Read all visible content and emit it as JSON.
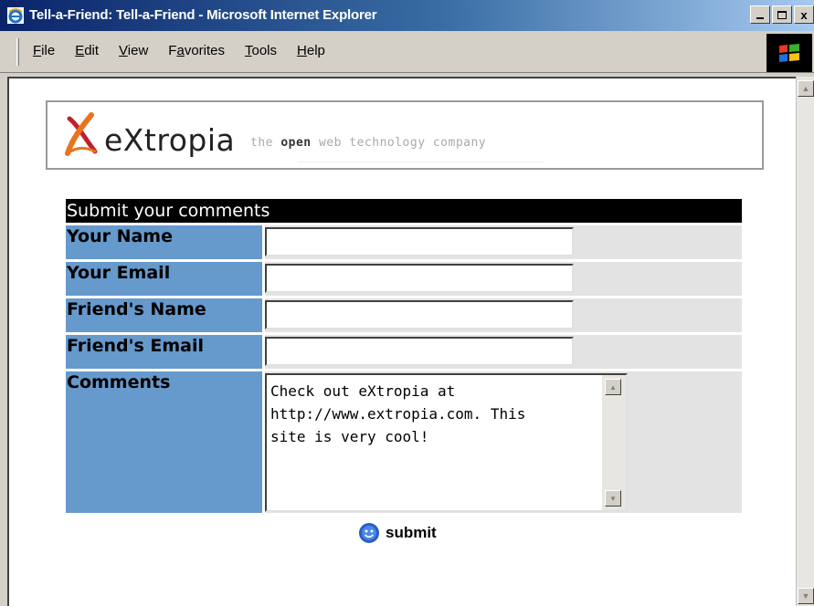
{
  "window": {
    "title": "Tell-a-Friend: Tell-a-Friend - Microsoft Internet Explorer",
    "controls": {
      "minimize": "_",
      "maximize": "□",
      "close": "x"
    }
  },
  "menu": {
    "items": [
      {
        "label": "File",
        "accel": "F"
      },
      {
        "label": "Edit",
        "accel": "E"
      },
      {
        "label": "View",
        "accel": "V"
      },
      {
        "label": "Favorites",
        "accel": "a"
      },
      {
        "label": "Tools",
        "accel": "T"
      },
      {
        "label": "Help",
        "accel": "H"
      }
    ]
  },
  "logo": {
    "wordmark": "eXtropia",
    "tagline_pre": "the ",
    "tagline_bold": "open",
    "tagline_post": " web technology company"
  },
  "form": {
    "header": "Submit your comments",
    "fields": [
      {
        "label": "Your Name",
        "value": ""
      },
      {
        "label": "Your Email",
        "value": ""
      },
      {
        "label": "Friend's Name",
        "value": ""
      },
      {
        "label": "Friend's Email",
        "value": ""
      }
    ],
    "comments_label": "Comments",
    "comments_value": "Check out eXtropia at\nhttp://www.extropia.com. This\nsite is very cool!",
    "submit_label": "submit"
  },
  "colors": {
    "label_bg": "#6699cc",
    "header_bg": "#000000",
    "input_cell_bg": "#e3e3e3",
    "titlebar_start": "#0a246a",
    "titlebar_end": "#a6caf0",
    "logo_accent": "#e8741c",
    "logo_accent2": "#c0202a"
  }
}
